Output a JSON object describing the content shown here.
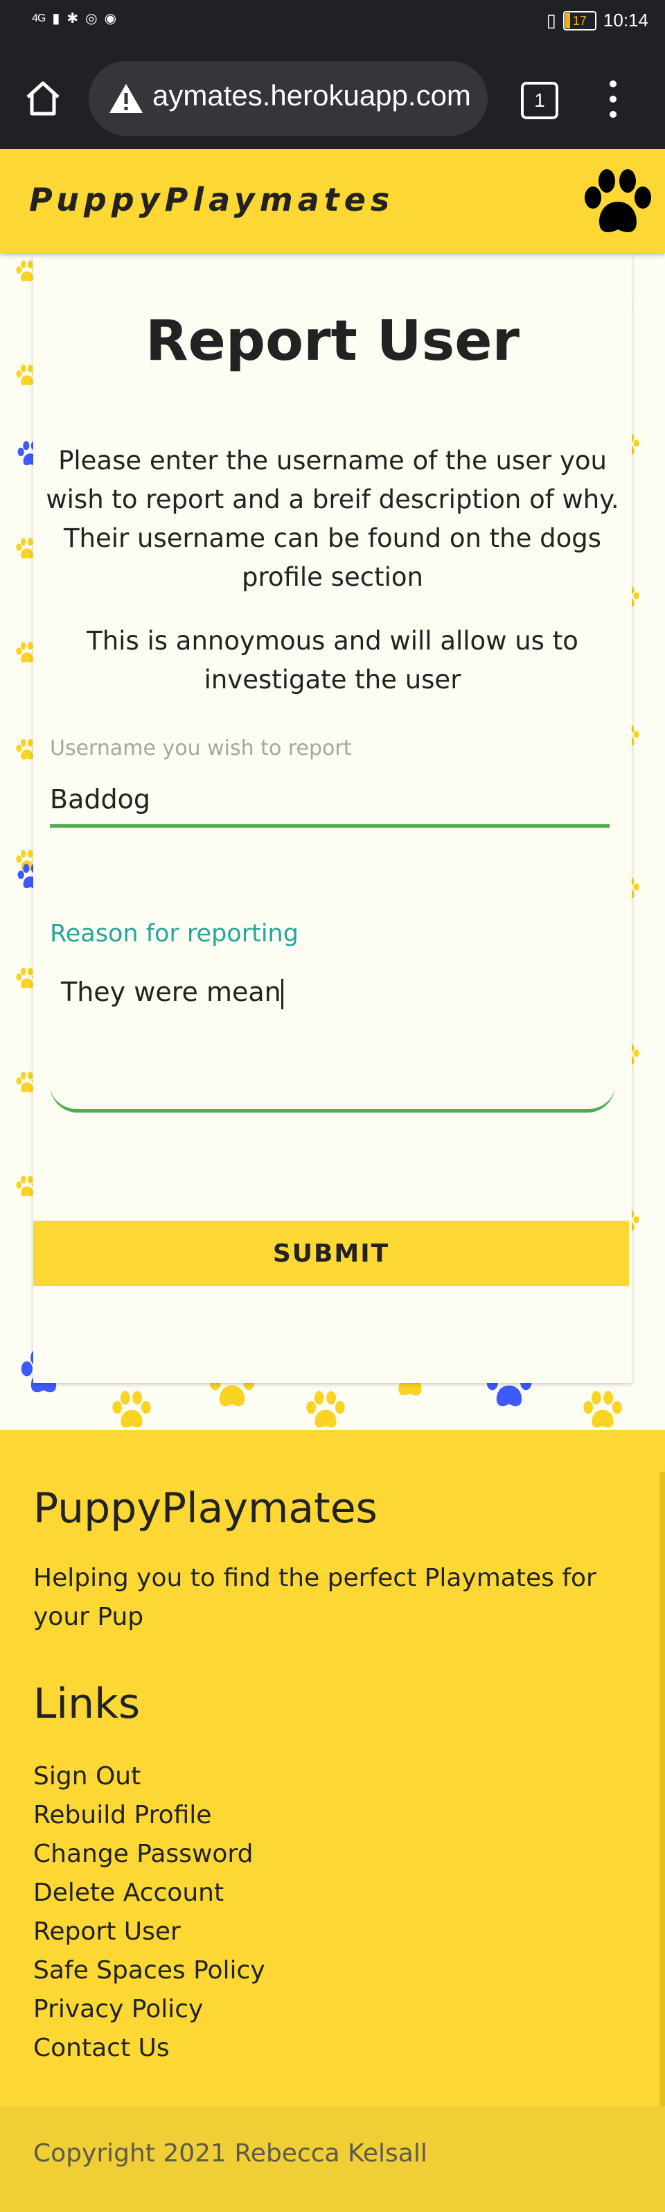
{
  "status_bar": {
    "network": "4G",
    "battery": "17",
    "time": "10:14"
  },
  "browser": {
    "url": "aymates.herokuapp.com",
    "tab_count": "1"
  },
  "navbar": {
    "brand": "PuppyPlaymates"
  },
  "form": {
    "title": "Report User",
    "intro": "Please enter the username of the user you wish to report and a breif description of why. Their username can be found on the dogs profile section",
    "note": "This is annoymous and will allow us to investigate the user",
    "username_label": "Username you wish to report",
    "username_value": "Baddog",
    "reason_label": "Reason for reporting",
    "reason_value": "They were mean",
    "submit_label": "SUBMIT"
  },
  "footer": {
    "brand": "PuppyPlaymates",
    "tagline": "Helping you to find the perfect Playmates for your Pup",
    "links_title": "Links",
    "links": [
      "Sign Out",
      "Rebuild Profile",
      "Change Password",
      "Delete Account",
      "Report User",
      "Safe Spaces Policy",
      "Privacy Policy",
      "Contact Us"
    ],
    "copyright": "Copyright 2021 Rebecca Kelsall"
  },
  "colors": {
    "brand_yellow": "#fdd835",
    "input_focus_green": "#4caf50",
    "label_teal": "#26a69a",
    "paw_blue": "#3d5afe",
    "paw_yellow": "#f9d423"
  }
}
